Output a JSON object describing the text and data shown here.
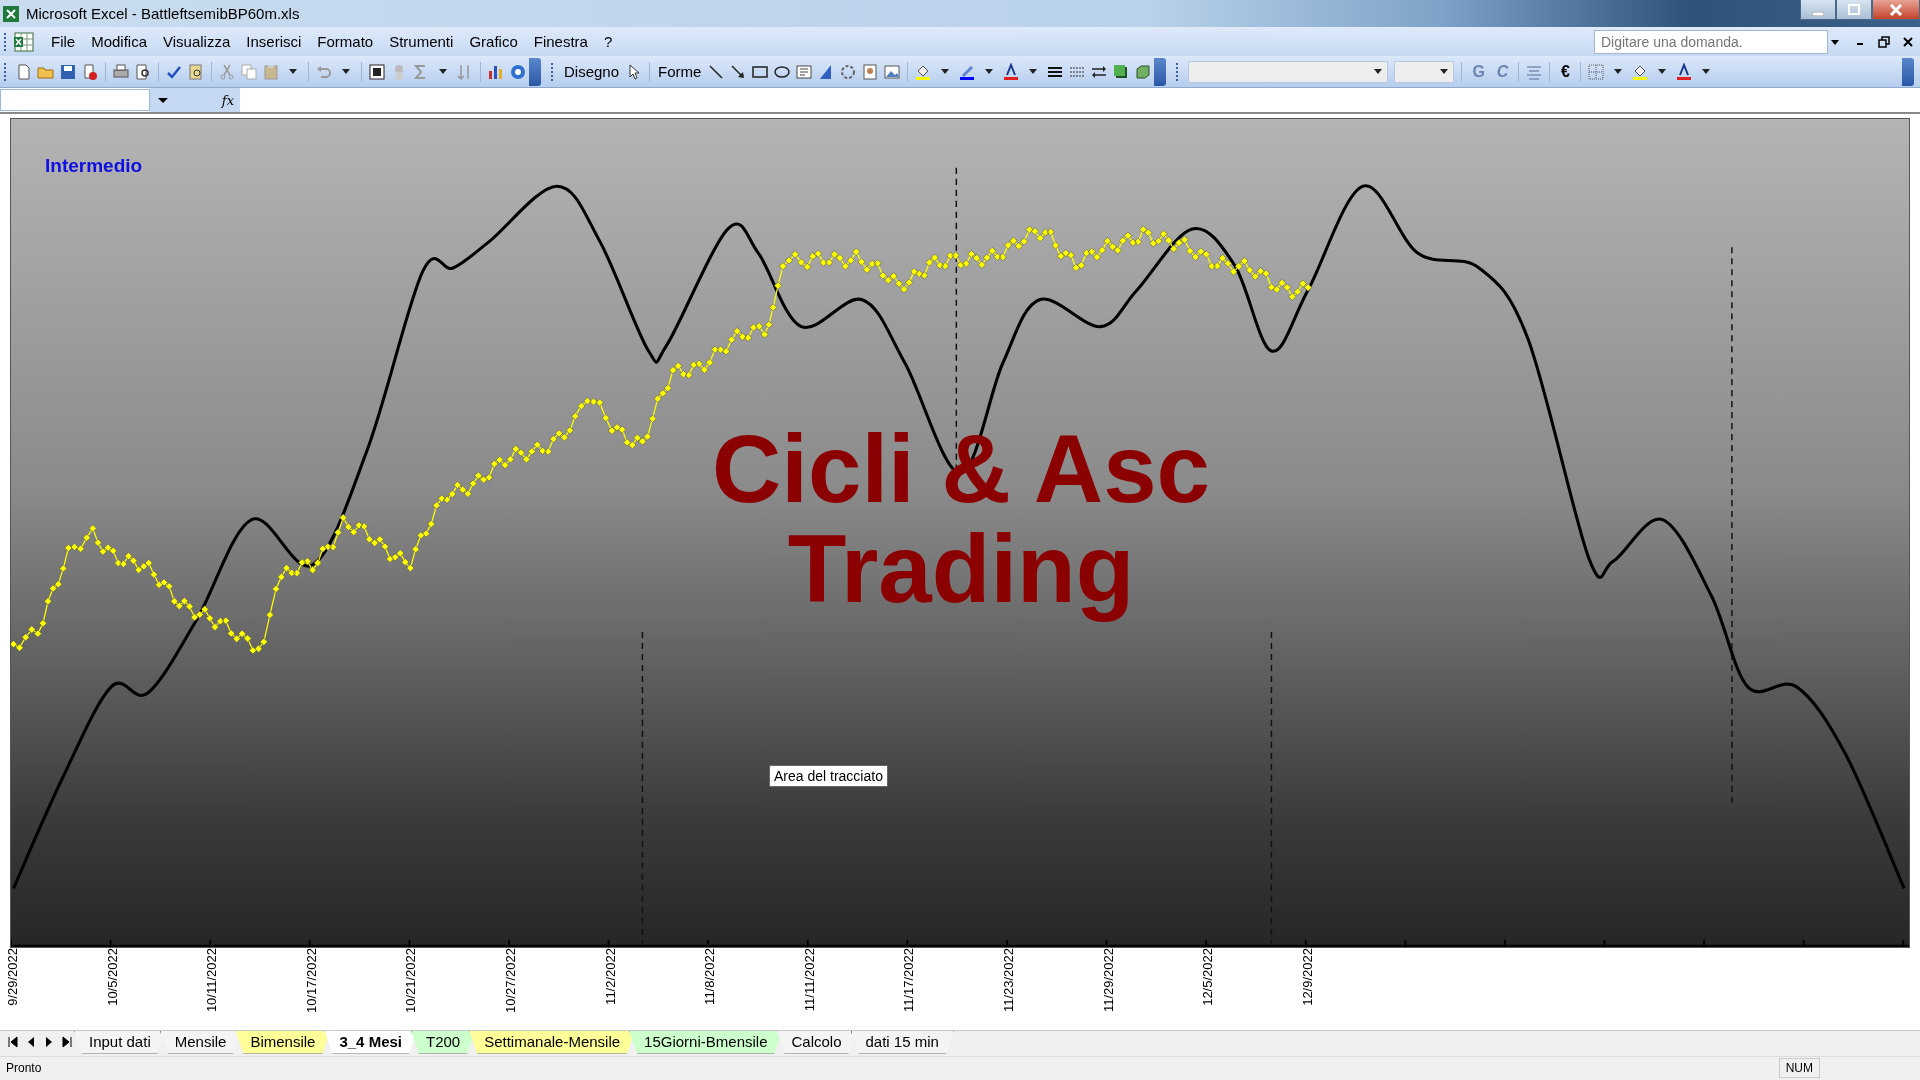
{
  "window": {
    "title": "Microsoft Excel - BattleftsemibBP60m.xls"
  },
  "menu": [
    {
      "label": "File"
    },
    {
      "label": "Modifica"
    },
    {
      "label": "Visualizza"
    },
    {
      "label": "Inserisci"
    },
    {
      "label": "Formato"
    },
    {
      "label": "Strumenti"
    },
    {
      "label": "Grafico"
    },
    {
      "label": "Finestra"
    },
    {
      "label": "?"
    }
  ],
  "help_box": {
    "placeholder": "Digitare una domanda."
  },
  "toolbar": {
    "drawing_menus": [
      "Disegno",
      "Forme"
    ],
    "format_buttons": [
      "G",
      "C"
    ],
    "currency_button": "€"
  },
  "formula_bar": {
    "function_label": "fx"
  },
  "chart": {
    "label": "Intermedio",
    "watermark_lines": [
      "Cicli & Asc",
      "Trading"
    ],
    "tooltip": "Area del tracciato",
    "x_labels": [
      "9/29/2022",
      "10/5/2022",
      "10/11/2022",
      "10/17/2022",
      "10/21/2022",
      "10/27/2022",
      "11/2/2022",
      "11/8/2022",
      "11/11/2022",
      "11/17/2022",
      "11/23/2022",
      "11/29/2022",
      "12/5/2022",
      "12/9/2022"
    ]
  },
  "sheet_tabs": [
    {
      "label": "Input dati",
      "selected": false,
      "color": "#f4f4f4"
    },
    {
      "label": "Mensile",
      "selected": false,
      "color": "#f4f4f4"
    },
    {
      "label": "Bimensile",
      "selected": false,
      "color": "#ffff99"
    },
    {
      "label": "3_4 Mesi",
      "selected": true,
      "color": "#ffffff"
    },
    {
      "label": "T200",
      "selected": false,
      "color": "#ccffcc"
    },
    {
      "label": "Settimanale-Mensile",
      "selected": false,
      "color": "#ffff99"
    },
    {
      "label": "15Giorni-Bmensile",
      "selected": false,
      "color": "#ccffcc"
    },
    {
      "label": "Calcolo",
      "selected": false,
      "color": "#f4f4f4"
    },
    {
      "label": "dati 15 min",
      "selected": false,
      "color": "#f4f4f4"
    }
  ],
  "status_bar": {
    "text": "Pronto",
    "indicators": [
      "NUM"
    ]
  }
}
